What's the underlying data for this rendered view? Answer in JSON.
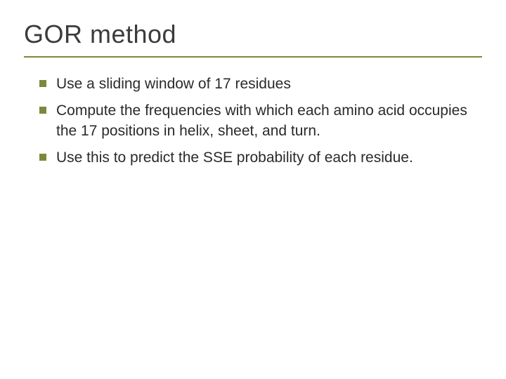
{
  "slide": {
    "title": "GOR method",
    "bullets": [
      "Use a sliding window of 17 residues",
      "Compute the frequencies with which each amino acid occupies the 17 positions in helix, sheet, and turn.",
      "Use this to predict the SSE probability of each residue."
    ]
  }
}
